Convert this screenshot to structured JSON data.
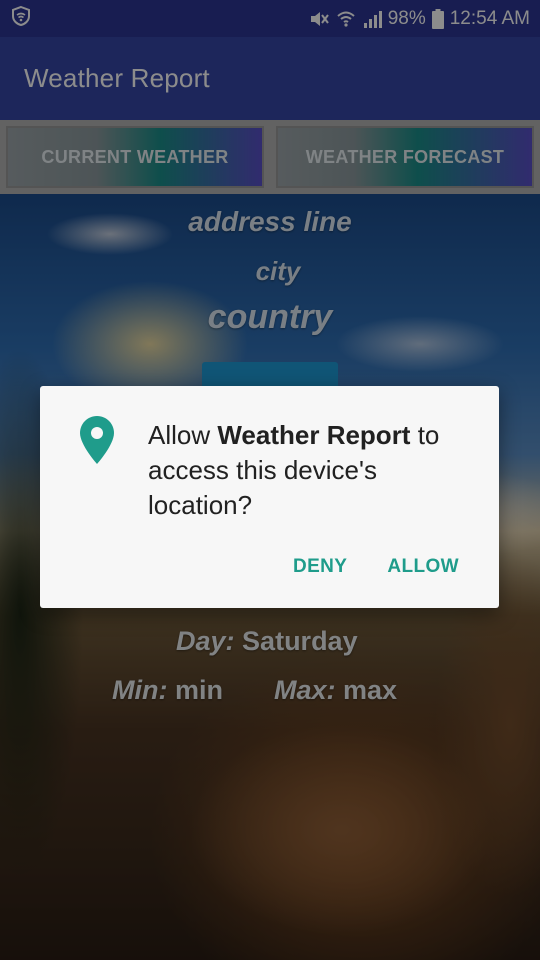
{
  "status_bar": {
    "battery_percent": "98%",
    "time": "12:54 AM",
    "icons": [
      "vpn-shield-icon",
      "mute-icon",
      "wifi-icon",
      "signal-icon",
      "battery-icon"
    ]
  },
  "app_bar": {
    "title": "Weather Report"
  },
  "tabs": [
    {
      "label": "CURRENT WEATHER"
    },
    {
      "label": "WEATHER FORECAST"
    }
  ],
  "location": {
    "address_line": "address line",
    "city": "city",
    "country": "country"
  },
  "weather": {
    "day_label": "Day:",
    "day_value": "Saturday",
    "min_label": "Min:",
    "min_value": "min",
    "max_label": "Max:",
    "max_value": "max"
  },
  "dialog": {
    "prefix": "Allow ",
    "app_name": "Weather Report",
    "suffix": " to access this device's location?",
    "deny_label": "DENY",
    "allow_label": "ALLOW",
    "icon": "location-pin-icon"
  },
  "colors": {
    "status_bar": "#2c3694",
    "app_bar": "#3646a6",
    "dialog_accent": "#1f9c8b",
    "tab_gradient_end": "#5a4fc9",
    "hidden_button": "#1e9bd8"
  }
}
